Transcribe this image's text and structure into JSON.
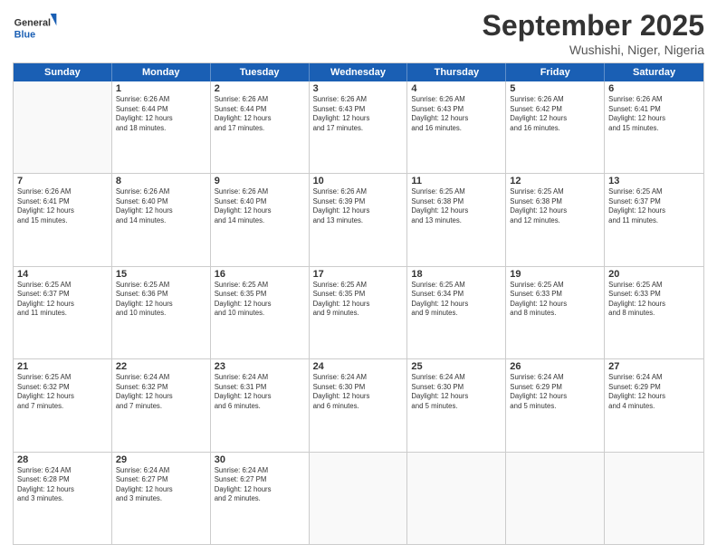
{
  "header": {
    "logo_general": "General",
    "logo_blue": "Blue",
    "month_year": "September 2025",
    "location": "Wushishi, Niger, Nigeria"
  },
  "days_of_week": [
    "Sunday",
    "Monday",
    "Tuesday",
    "Wednesday",
    "Thursday",
    "Friday",
    "Saturday"
  ],
  "rows": [
    [
      {
        "day": "",
        "info": ""
      },
      {
        "day": "1",
        "info": "Sunrise: 6:26 AM\nSunset: 6:44 PM\nDaylight: 12 hours\nand 18 minutes."
      },
      {
        "day": "2",
        "info": "Sunrise: 6:26 AM\nSunset: 6:44 PM\nDaylight: 12 hours\nand 17 minutes."
      },
      {
        "day": "3",
        "info": "Sunrise: 6:26 AM\nSunset: 6:43 PM\nDaylight: 12 hours\nand 17 minutes."
      },
      {
        "day": "4",
        "info": "Sunrise: 6:26 AM\nSunset: 6:43 PM\nDaylight: 12 hours\nand 16 minutes."
      },
      {
        "day": "5",
        "info": "Sunrise: 6:26 AM\nSunset: 6:42 PM\nDaylight: 12 hours\nand 16 minutes."
      },
      {
        "day": "6",
        "info": "Sunrise: 6:26 AM\nSunset: 6:41 PM\nDaylight: 12 hours\nand 15 minutes."
      }
    ],
    [
      {
        "day": "7",
        "info": "Sunrise: 6:26 AM\nSunset: 6:41 PM\nDaylight: 12 hours\nand 15 minutes."
      },
      {
        "day": "8",
        "info": "Sunrise: 6:26 AM\nSunset: 6:40 PM\nDaylight: 12 hours\nand 14 minutes."
      },
      {
        "day": "9",
        "info": "Sunrise: 6:26 AM\nSunset: 6:40 PM\nDaylight: 12 hours\nand 14 minutes."
      },
      {
        "day": "10",
        "info": "Sunrise: 6:26 AM\nSunset: 6:39 PM\nDaylight: 12 hours\nand 13 minutes."
      },
      {
        "day": "11",
        "info": "Sunrise: 6:25 AM\nSunset: 6:38 PM\nDaylight: 12 hours\nand 13 minutes."
      },
      {
        "day": "12",
        "info": "Sunrise: 6:25 AM\nSunset: 6:38 PM\nDaylight: 12 hours\nand 12 minutes."
      },
      {
        "day": "13",
        "info": "Sunrise: 6:25 AM\nSunset: 6:37 PM\nDaylight: 12 hours\nand 11 minutes."
      }
    ],
    [
      {
        "day": "14",
        "info": "Sunrise: 6:25 AM\nSunset: 6:37 PM\nDaylight: 12 hours\nand 11 minutes."
      },
      {
        "day": "15",
        "info": "Sunrise: 6:25 AM\nSunset: 6:36 PM\nDaylight: 12 hours\nand 10 minutes."
      },
      {
        "day": "16",
        "info": "Sunrise: 6:25 AM\nSunset: 6:35 PM\nDaylight: 12 hours\nand 10 minutes."
      },
      {
        "day": "17",
        "info": "Sunrise: 6:25 AM\nSunset: 6:35 PM\nDaylight: 12 hours\nand 9 minutes."
      },
      {
        "day": "18",
        "info": "Sunrise: 6:25 AM\nSunset: 6:34 PM\nDaylight: 12 hours\nand 9 minutes."
      },
      {
        "day": "19",
        "info": "Sunrise: 6:25 AM\nSunset: 6:33 PM\nDaylight: 12 hours\nand 8 minutes."
      },
      {
        "day": "20",
        "info": "Sunrise: 6:25 AM\nSunset: 6:33 PM\nDaylight: 12 hours\nand 8 minutes."
      }
    ],
    [
      {
        "day": "21",
        "info": "Sunrise: 6:25 AM\nSunset: 6:32 PM\nDaylight: 12 hours\nand 7 minutes."
      },
      {
        "day": "22",
        "info": "Sunrise: 6:24 AM\nSunset: 6:32 PM\nDaylight: 12 hours\nand 7 minutes."
      },
      {
        "day": "23",
        "info": "Sunrise: 6:24 AM\nSunset: 6:31 PM\nDaylight: 12 hours\nand 6 minutes."
      },
      {
        "day": "24",
        "info": "Sunrise: 6:24 AM\nSunset: 6:30 PM\nDaylight: 12 hours\nand 6 minutes."
      },
      {
        "day": "25",
        "info": "Sunrise: 6:24 AM\nSunset: 6:30 PM\nDaylight: 12 hours\nand 5 minutes."
      },
      {
        "day": "26",
        "info": "Sunrise: 6:24 AM\nSunset: 6:29 PM\nDaylight: 12 hours\nand 5 minutes."
      },
      {
        "day": "27",
        "info": "Sunrise: 6:24 AM\nSunset: 6:29 PM\nDaylight: 12 hours\nand 4 minutes."
      }
    ],
    [
      {
        "day": "28",
        "info": "Sunrise: 6:24 AM\nSunset: 6:28 PM\nDaylight: 12 hours\nand 3 minutes."
      },
      {
        "day": "29",
        "info": "Sunrise: 6:24 AM\nSunset: 6:27 PM\nDaylight: 12 hours\nand 3 minutes."
      },
      {
        "day": "30",
        "info": "Sunrise: 6:24 AM\nSunset: 6:27 PM\nDaylight: 12 hours\nand 2 minutes."
      },
      {
        "day": "",
        "info": ""
      },
      {
        "day": "",
        "info": ""
      },
      {
        "day": "",
        "info": ""
      },
      {
        "day": "",
        "info": ""
      }
    ]
  ]
}
